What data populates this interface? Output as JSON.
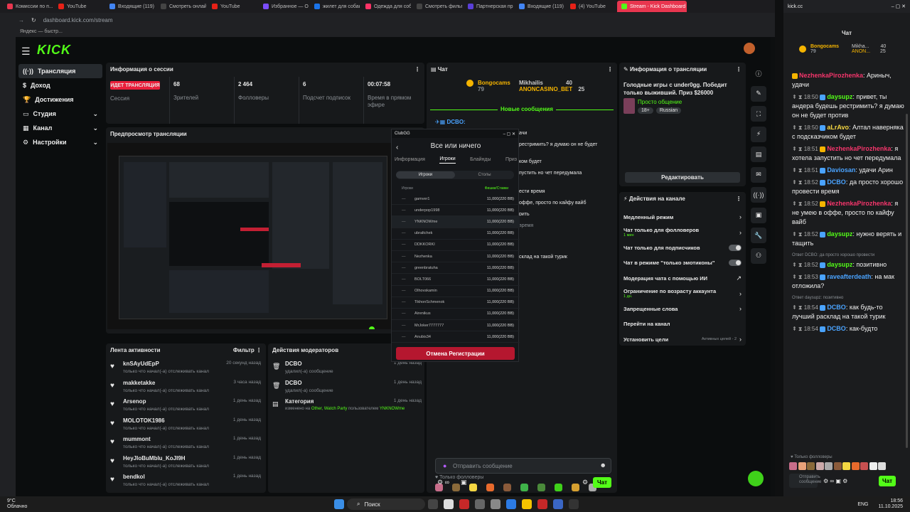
{
  "browser": {
    "tabs": [
      "Комиссии по п...",
      "YouTube",
      "Входящие (119)",
      "Смотреть онлай...",
      "YouTube",
      "Избранное — O...",
      "жилет для собак...",
      "Одежда для соб...",
      "Смотреть фильм...",
      "Партнерская пр...",
      "Входящие (119)",
      "(4) YouTube",
      "Stream - Kick Dashboard"
    ],
    "active_tab": "Stream - Kick Dashboard",
    "url": "dashboard.kick.com/stream",
    "bookmark": "Яндекс — быстр..."
  },
  "sidebar": {
    "items": [
      {
        "label": "Трансляция",
        "selected": true
      },
      {
        "label": "Доход"
      },
      {
        "label": "Достижения"
      },
      {
        "label": "Студия",
        "chevron": true
      },
      {
        "label": "Канал",
        "chevron": true
      },
      {
        "label": "Настройки",
        "chevron": true
      }
    ]
  },
  "session": {
    "title": "Информация о сессии",
    "live_badge": "ИДЕТ ТРАНСЛЯЦИЯ",
    "session_label": "Сессия",
    "stats": [
      {
        "value": "68",
        "label": "Зрителей"
      },
      {
        "value": "2 464",
        "label": "Фолловеры"
      },
      {
        "value": "6",
        "label": "Подсчет подписок"
      },
      {
        "value": "00:07:58",
        "label": "Время в прямом эфире"
      }
    ]
  },
  "preview": {
    "title": "Предпросмотр трансляции"
  },
  "activity": {
    "title": "Лента активности",
    "filter": "Фильтр",
    "items": [
      {
        "user": "knSAyUdEpP",
        "text": "только что начал(-а) отслеживать канал",
        "time": "20 секунд назад"
      },
      {
        "user": "makketakke",
        "text": "только что начал(-а) отслеживать канал",
        "time": "3 часа назад"
      },
      {
        "user": "Arsenop",
        "text": "только что начал(-а) отслеживать канал",
        "time": "1 день назад"
      },
      {
        "user": "MOLOTOK1986",
        "text": "только что начал(-а) отслеживать канал",
        "time": "1 день назад"
      },
      {
        "user": "mummont",
        "text": "только что начал(-а) отслеживать канал",
        "time": "1 день назад"
      },
      {
        "user": "HeyJloBuMblu_KoJI9H",
        "text": "только что начал(-а) отслеживать канал",
        "time": "1 день назад"
      },
      {
        "user": "bendkol",
        "text": "только что начал(-а) отслеживать канал",
        "time": "1 день назад"
      }
    ]
  },
  "modactions": {
    "title": "Действия модераторов",
    "items": [
      {
        "user": "DCBO",
        "text": "удалил(-а) сообщение",
        "time": "1 день назад"
      },
      {
        "user": "DCBO",
        "text": "удалил(-а) сообщение",
        "time": "1 день назад"
      },
      {
        "user": "Категория",
        "text_pre": "изменено на",
        "highlight": "Other, Watch Party",
        "text_mid": "пользователем",
        "by": "YNKNOWme",
        "time": "1 день назад"
      }
    ]
  },
  "chat": {
    "title": "Чат",
    "top": [
      {
        "name": "Bongocams",
        "value": "79"
      },
      {
        "name": "Mikhailis",
        "value": "40"
      },
      {
        "name": "ANONCASINO_BET",
        "value": "25"
      }
    ],
    "new_messages": "Новые сообщения",
    "followers_only": "Только фолловеры",
    "placeholder": "Отправить сообщение",
    "send": "Чат"
  },
  "overlay": {
    "app": "ClubGG",
    "title": "Все или ничего",
    "tabs": [
      "Информация",
      "Игроки",
      "Блайнды",
      "Приз"
    ],
    "subtabs": [
      "Игроки",
      "Столы"
    ],
    "headers": [
      "Игроки",
      "Фишки/Ставки"
    ],
    "players": [
      {
        "name": "gamver1",
        "chips": "11,000(220 BB)"
      },
      {
        "name": "underpop1998",
        "chips": "11,000(220 BB)"
      },
      {
        "name": "YNKNOWme",
        "chips": "11,000(220 BB)"
      },
      {
        "name": "ubraltchek",
        "chips": "11,000(220 BB)"
      },
      {
        "name": "DDKKORKI",
        "chips": "11,000(220 BB)"
      },
      {
        "name": "Nezhenka",
        "chips": "11,000(220 BB)"
      },
      {
        "name": "greenbratuha",
        "chips": "11,000(220 BB)"
      },
      {
        "name": "BOLT066",
        "chips": "11,000(220 BB)"
      },
      {
        "name": "Olhovskamin",
        "chips": "11,000(220 BB)"
      },
      {
        "name": "TikhonSchmenok",
        "chips": "11,000(220 BB)"
      },
      {
        "name": "Airenikus",
        "chips": "11,000(220 BB)"
      },
      {
        "name": "MrJoker7777777",
        "chips": "11,000(220 BB)"
      },
      {
        "name": "Anubis34",
        "chips": "11,000(220 BB)"
      }
    ],
    "button": "Отмена Регистрации",
    "chat_fragments": [
      "ачи",
      "рестримить? я думаю он не будет",
      "ком будет",
      "пустить но чет передумала",
      "ести время",
      "оффе, просто по кайфу вайб",
      "рить",
      "время",
      "склад на такой турик"
    ]
  },
  "streaminfo": {
    "title": "Информация о трансляции",
    "stream_title": "Голодные игры с under0gg. Победит только выживший. Приз $26000",
    "category": "Просто общение",
    "tags": [
      "18+",
      "Russian"
    ],
    "edit": "Редактировать"
  },
  "channel_actions": {
    "title": "Действия на канале",
    "items": [
      {
        "label": "Медленный режим",
        "type": "chevron"
      },
      {
        "label": "Чат только для фолловеров",
        "sub": "1 мин",
        "type": "chevron"
      },
      {
        "label": "Чат только для подписчиков",
        "type": "toggle"
      },
      {
        "label": "Чат в режиме \"только эмотиконы\"",
        "type": "toggle"
      },
      {
        "label": "Модерация чата с помощью ИИ",
        "type": "link"
      },
      {
        "label": "Ограничение по возрасту аккаунта",
        "sub": "1 дн.",
        "type": "chevron"
      },
      {
        "label": "Запрещенные слова",
        "type": "chevron"
      },
      {
        "label": "Перейти на канал",
        "type": "none"
      },
      {
        "label": "Установить цели",
        "extra": "Активных целей - 2",
        "type": "chevron"
      }
    ]
  },
  "right_chat": {
    "url": "kick.cc",
    "title": "Чат",
    "top": [
      {
        "name": "Bongocams",
        "value": "79"
      },
      {
        "name": "Mikha...",
        "value": "40"
      },
      {
        "name": "ANON...",
        "value": "25"
      }
    ],
    "messages": [
      {
        "user": "NezhenkaPirozhenka",
        "text": "Ариныч, удачи",
        "color": "#f4356b"
      },
      {
        "time": "18:50",
        "user": "daysupz",
        "text": "привет, ты андера будешь рестримить? я думаю он не будет против",
        "color": "#53fc18"
      },
      {
        "time": "18:50",
        "user": "aLrAvo",
        "text": "Алтал наверняка с подсказчиком будет",
        "color": "#f5d742"
      },
      {
        "time": "18:51",
        "user": "NezhenkaPirozhenka",
        "text": "я хотела запустить но чет передумала",
        "color": "#f4356b"
      },
      {
        "time": "18:51",
        "user": "Daviosan",
        "text": "удачи Арин",
        "color": "#4aa3ff"
      },
      {
        "time": "18:52",
        "user": "DCBO",
        "text": "да просто хорошо провести время",
        "color": "#4aa3ff"
      },
      {
        "time": "18:52",
        "user": "NezhenkaPirozhenka",
        "text": "я не умею в оффе, просто по кайфу вайб",
        "color": "#f4356b"
      },
      {
        "time": "18:52",
        "user": "daysupz",
        "text": "нужно верять и тащить",
        "color": "#53fc18"
      },
      {
        "reply": "Ответ DCBO: да просто хорошо провести",
        "time": "18:52",
        "user": "daysupz",
        "text": "позитивно",
        "color": "#53fc18"
      },
      {
        "time": "18:53",
        "user": "raveafterdeath",
        "text": "на мак отложила?",
        "color": "#4aa3ff"
      },
      {
        "reply": "Ответ daysupz: позитивно",
        "time": "18:54",
        "user": "DCBO",
        "text": "как будь-то лучший расклад на такой турик",
        "color": "#4aa3ff"
      },
      {
        "time": "18:54",
        "user": "DCBO",
        "text": "как-будто",
        "color": "#4aa3ff"
      }
    ],
    "followers_only": "Только фолловеры",
    "placeholder": "Отправить сообщение",
    "send": "Чат"
  },
  "taskbar": {
    "weather_temp": "9°C",
    "weather_desc": "Облачно",
    "search": "Поиск",
    "lang": "ENG",
    "time": "18:56",
    "date": "11.10.2025"
  }
}
